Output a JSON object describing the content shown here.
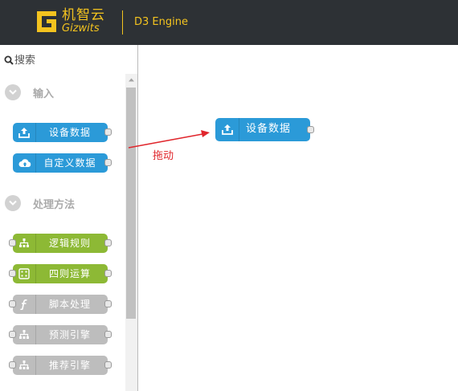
{
  "header": {
    "logo_cn": "机智云",
    "logo_en": "Gizwits",
    "app_title": "D3 Engine"
  },
  "palette": {
    "search": {
      "placeholder": "搜索",
      "value": ""
    },
    "categories": [
      {
        "label": "输入",
        "nodes": [
          {
            "label": "设备数据",
            "icon": "upload-icon"
          },
          {
            "label": "自定义数据",
            "icon": "cloud-upload-icon"
          }
        ]
      },
      {
        "label": "处理方法",
        "nodes": [
          {
            "label": "逻辑规则",
            "icon": "sitemap-icon"
          },
          {
            "label": "四则运算",
            "icon": "calculator-icon"
          },
          {
            "label": "脚本处理",
            "icon": "function-icon"
          },
          {
            "label": "预测引擎",
            "icon": "sitemap-icon"
          },
          {
            "label": "推荐引擎",
            "icon": "sitemap-icon"
          }
        ]
      }
    ]
  },
  "workspace": {
    "node": {
      "label": "设备数据",
      "icon": "upload-icon"
    },
    "drag_hint": "拖动"
  },
  "colors": {
    "header_bg": "#2d3135",
    "brand_yellow": "#f3c31f",
    "input_node": "#2b9ad8",
    "function_node": "#8db935",
    "disabled_node": "#bdbdbd",
    "drag_arrow": "#e0262c"
  }
}
